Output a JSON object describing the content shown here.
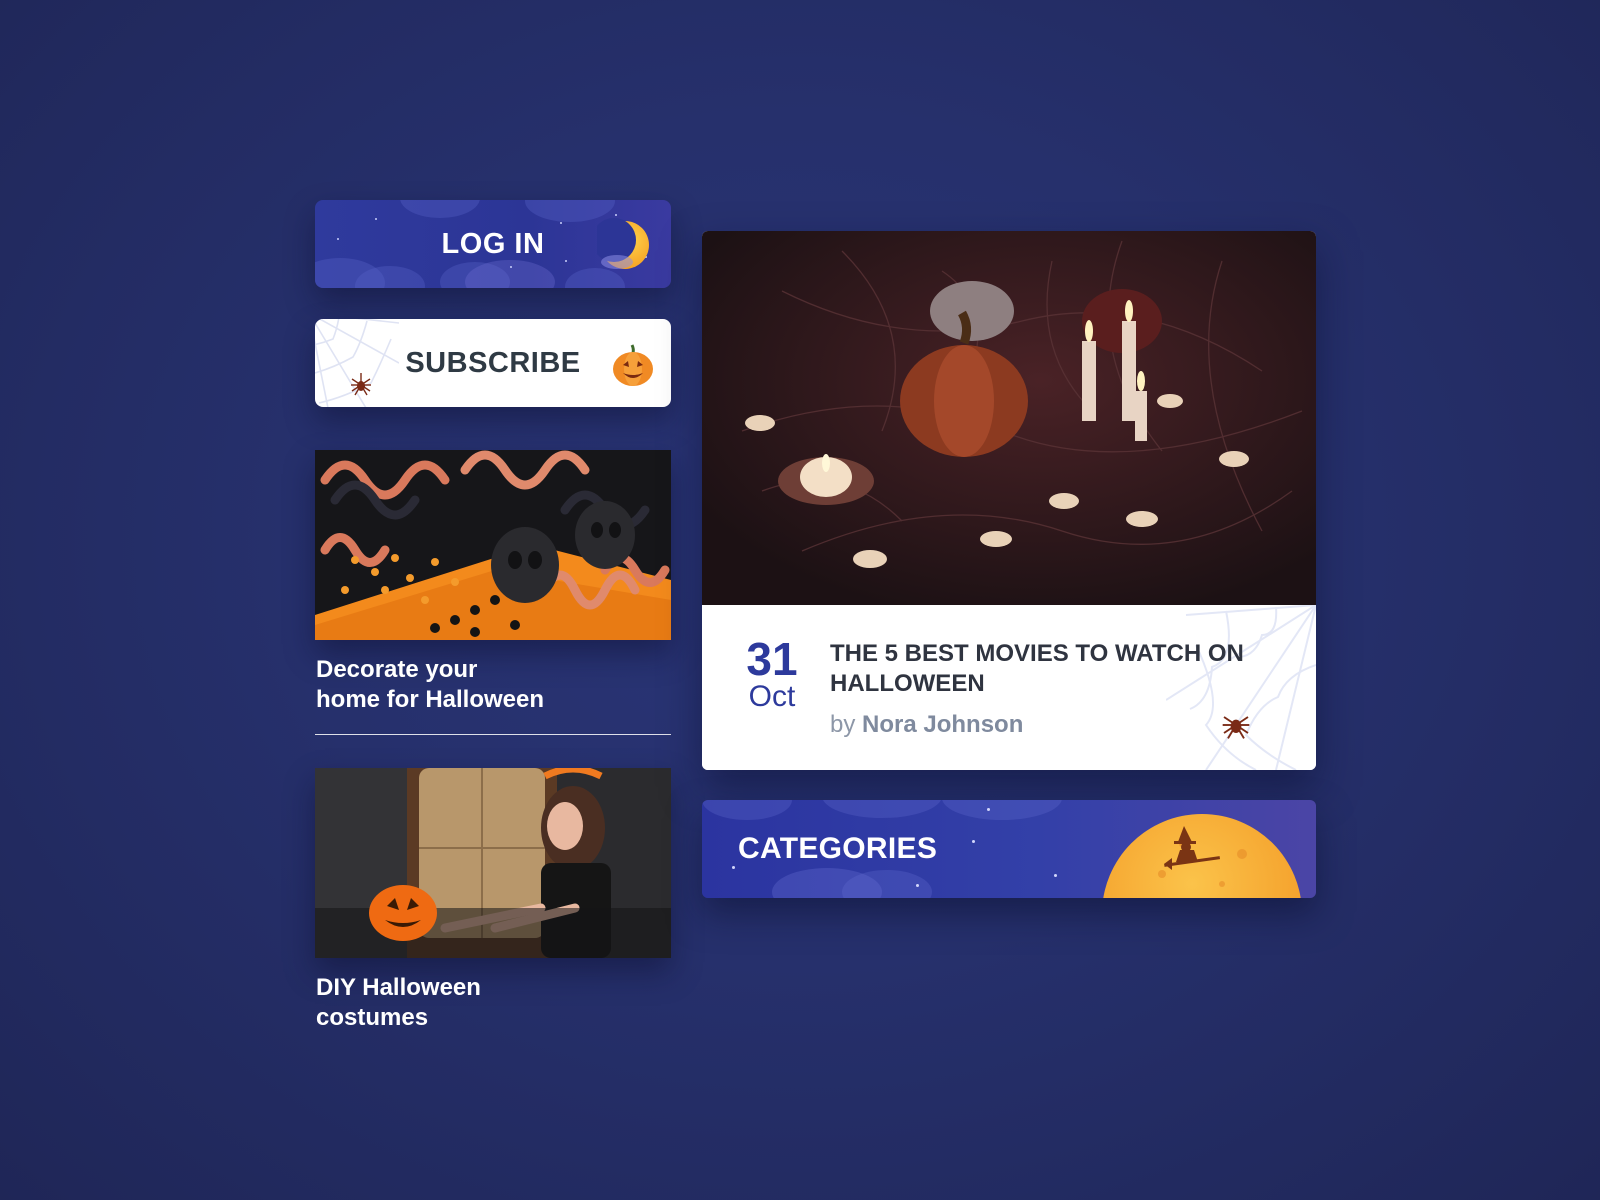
{
  "buttons": {
    "login_label": "LOG IN",
    "subscribe_label": "SUBSCRIBE"
  },
  "small_cards": [
    {
      "caption_line1": "Decorate your",
      "caption_line2": "home for Halloween"
    },
    {
      "caption_line1": "DIY Halloween",
      "caption_line2": "costumes"
    }
  ],
  "feature": {
    "day": "31",
    "month": "Oct",
    "title": "THE 5 BEST MOVIES TO WATCH ON HALLOWEEN",
    "by_prefix": "by",
    "author": "Nora Johnson"
  },
  "categories": {
    "label": "CATEGORIES"
  },
  "colors": {
    "background": "#26306c",
    "accent_blue": "#2d3a9c",
    "accent_orange": "#f28c28",
    "moon_yellow": "#f7b33c"
  },
  "icons": [
    "crescent-moon-icon",
    "pumpkin-icon",
    "spider-icon",
    "spiderweb-icon",
    "witch-icon",
    "full-moon-icon"
  ]
}
